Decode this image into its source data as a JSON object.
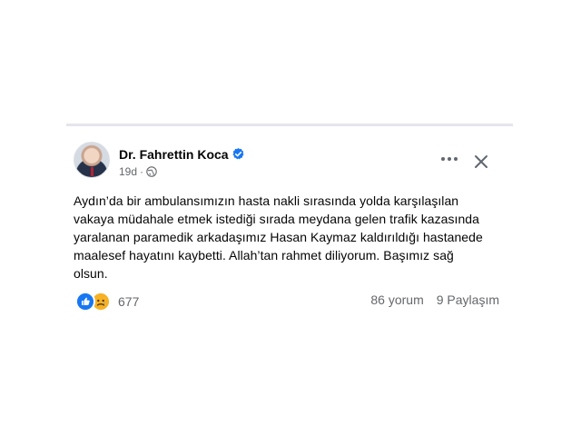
{
  "post": {
    "author": "Dr. Fahrettin Koca",
    "timestamp": "19d",
    "visibility_icon": "globe-icon",
    "verified_icon": "verified-badge-icon",
    "text_lines": [
      "Aydın’da bir ambulansımızın hasta nakli sırasında yolda karşılaşılan",
      "vakaya müdahale etmek istediği sırada meydana gelen trafik kazasında",
      "yaralanan paramedik arkadaşımız Hasan Kaymaz kaldırıldığı hastanede",
      "maalesef hayatını kaybetti. Allah’tan rahmet diliyorum. Başımız sağ",
      "olsun."
    ],
    "reactions": {
      "icons": [
        "like-icon",
        "sad-icon"
      ],
      "count": "677"
    },
    "comments": "86 yorum",
    "shares": "9 Paylaşım"
  },
  "colors": {
    "text_primary": "#050505",
    "text_secondary": "#65676b",
    "accent_blue": "#1877f2",
    "sad_yellow": "#f7b125"
  }
}
